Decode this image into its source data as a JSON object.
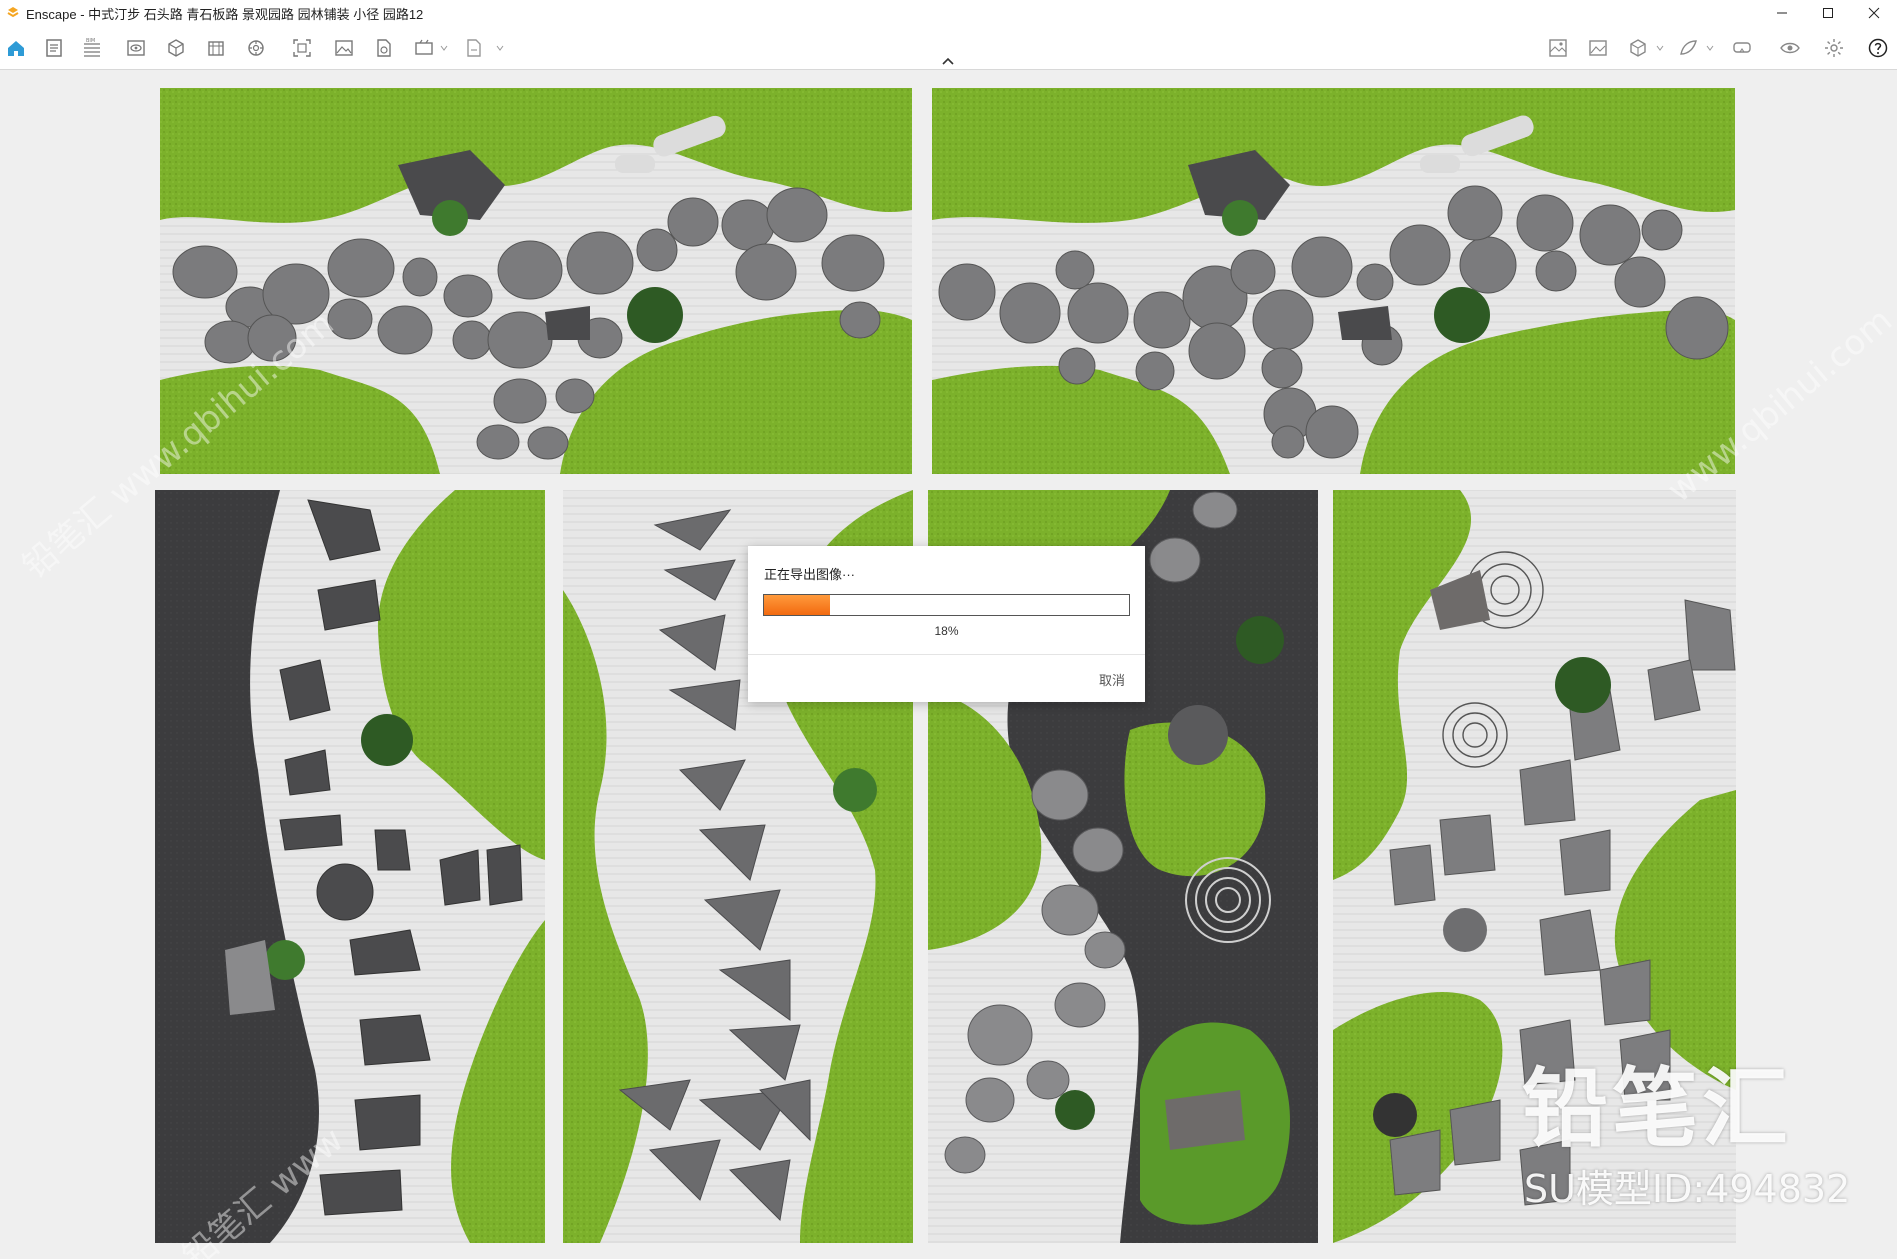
{
  "window": {
    "title": "Enscape - 中式汀步 石头路 青石板路 景观园路 园林铺装 小径 园路12",
    "controls": [
      "minimize",
      "maximize",
      "close"
    ]
  },
  "toolbar": {
    "left_icons": [
      "home-icon",
      "document-icon",
      "bim-icon",
      "eye-view-icon",
      "asset-icon",
      "layers-icon",
      "settings-icon",
      "capture-icon",
      "image-icon",
      "file-export-icon",
      "video-icon",
      "export-icon"
    ],
    "right_icons": [
      "frame-icon",
      "gallery-icon",
      "cube-icon",
      "material-icon",
      "vr-icon",
      "visibility-icon",
      "gear-icon",
      "help-icon"
    ]
  },
  "dialog": {
    "title": "正在导出图像···",
    "progress_percent": 18,
    "progress_label": "18%",
    "cancel_label": "取消",
    "accent": "#f26a10"
  },
  "watermark": {
    "brand": "铅笔汇",
    "model_id": "SU模型ID:494832",
    "diagonal_text": [
      "铅笔汇 www.qbihui.com",
      "铅笔汇 www",
      "www.qbihui.com"
    ]
  },
  "colors": {
    "grass": "#7bb02a",
    "gravel": "#e6e6e6",
    "stone": "#7c7c7e",
    "dark_ground": "#3a3a3c"
  }
}
